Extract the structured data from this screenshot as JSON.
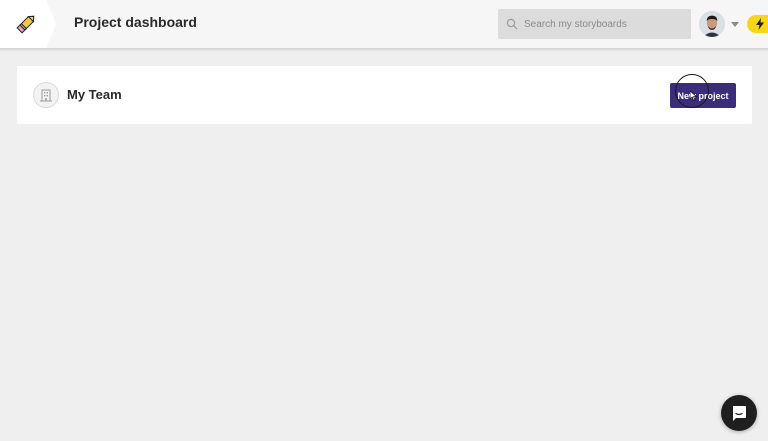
{
  "header": {
    "title": "Project dashboard",
    "logo_icon": "pencil-eraser-logo",
    "search": {
      "placeholder": "Search my storyboards",
      "value": ""
    },
    "user_menu_icon": "chevron-down-icon",
    "upgrade_badge_icon": "lightning-bolt-icon"
  },
  "team": {
    "name": "My Team",
    "icon": "building-icon",
    "new_project_label": "New project"
  },
  "chat": {
    "icon": "chat-icon"
  },
  "colors": {
    "background": "#efefef",
    "button": "#3b2d7a",
    "badge": "#f6d61b",
    "chat": "#1f1f1f"
  }
}
